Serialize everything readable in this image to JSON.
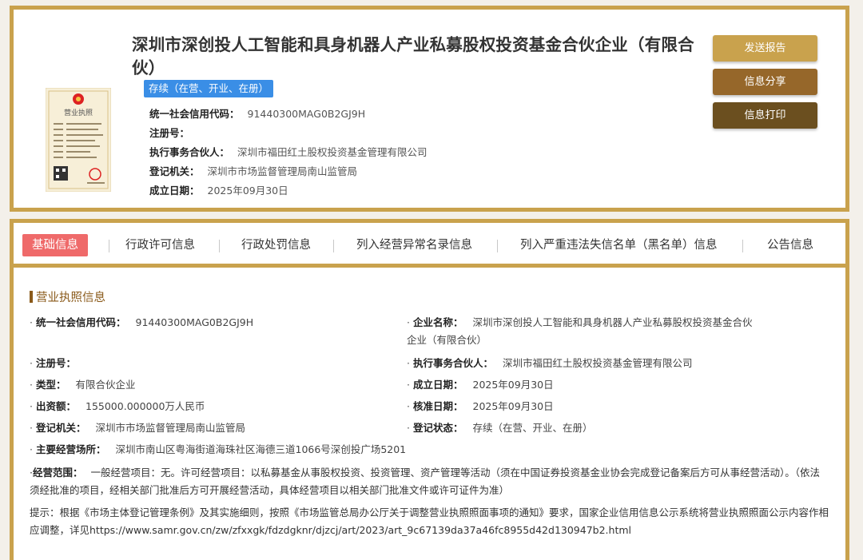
{
  "company": {
    "name": "深圳市深创投人工智能和具身机器人产业私募股权投资基金合伙企业（有限合伙）",
    "status": "存续（在营、开业、在册）",
    "credit_code_label": "统一社会信用代码：",
    "credit_code": "91440300MAG0B2GJ9H",
    "reg_no_label": "注册号：",
    "reg_no": "",
    "partner_label": "执行事务合伙人：",
    "partner": "深圳市福田红土股权投资基金管理有限公司",
    "authority_label": "登记机关：",
    "authority": "深圳市市场监督管理局南山监管局",
    "date_label": "成立日期：",
    "date": "2025年09月30日",
    "license_icon": "business-license-image",
    "license_title": "营业执照"
  },
  "actions": {
    "send": "发送报告",
    "share": "信息分享",
    "print": "信息打印"
  },
  "tabs": [
    {
      "label": "基础信息",
      "active": true
    },
    {
      "label": "行政许可信息"
    },
    {
      "label": "行政处罚信息"
    },
    {
      "label": "列入经营异常名录信息"
    },
    {
      "label": "列入严重违法失信名单（黑名单）信息"
    },
    {
      "label": "公告信息"
    }
  ],
  "section": {
    "title": "营业执照信息"
  },
  "details": {
    "credit_code": {
      "label": "统一社会信用代码：",
      "value": "91440300MAG0B2GJ9H"
    },
    "name": {
      "label": "企业名称：",
      "value_line1": "深圳市深创投人工智能和具身机器人产业私募股权投资基金合伙",
      "value_line2": "企业（有限合伙）"
    },
    "reg_no": {
      "label": "注册号：",
      "value": ""
    },
    "partner": {
      "label": "执行事务合伙人：",
      "value": "深圳市福田红土股权投资基金管理有限公司"
    },
    "type": {
      "label": "类型：",
      "value": "有限合伙企业"
    },
    "established": {
      "label": "成立日期：",
      "value": "2025年09月30日"
    },
    "capital": {
      "label": "出资额：",
      "value": "155000.000000万人民币"
    },
    "approved": {
      "label": "核准日期：",
      "value": "2025年09月30日"
    },
    "authority": {
      "label": "登记机关：",
      "value": "深圳市市场监督管理局南山监管局"
    },
    "reg_status": {
      "label": "登记状态：",
      "value": "存续（在营、开业、在册）"
    },
    "address": {
      "label": "主要经营场所：",
      "value": "深圳市南山区粤海街道海珠社区海德三道1066号深创投广场5201"
    },
    "scope": {
      "label": "经营范围：",
      "value": "一般经营项目：无。许可经营项目：以私募基金从事股权投资、投资管理、资产管理等活动（须在中国证券投资基金业协会完成登记备案后方可从事经营活动）。（依法须经批准的项目，经相关部门批准后方可开展经营活动，具体经营项目以相关部门批准文件或许可证件为准）"
    }
  },
  "hint": "提示：根据《市场主体登记管理条例》及其实施细则，按照《市场监管总局办公厅关于调整营业执照照面事项的通知》要求，国家企业信用信息公示系统将营业执照照面公示内容作相应调整，详见https://www.samr.gov.cn/zw/zfxxgk/fdzdgknr/djzcj/art/2023/art_9c67139da37a46fc8955d42d130947b2.html"
}
